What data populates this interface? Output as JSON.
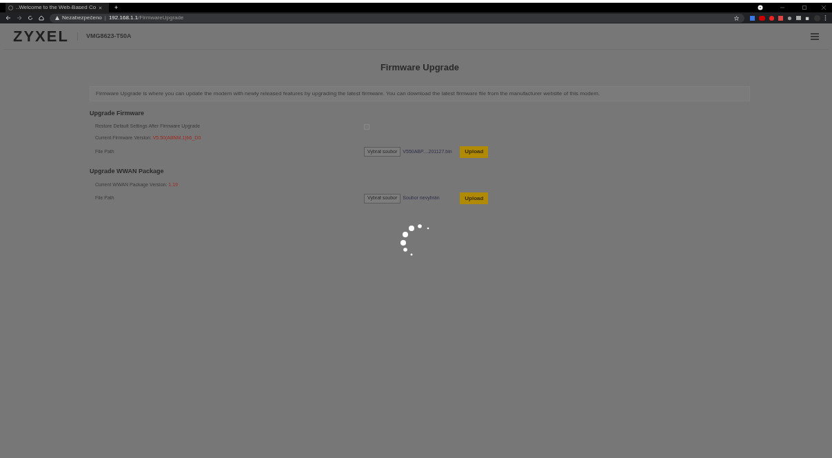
{
  "browser": {
    "tab_title": "..Welcome to the Web-Based Co",
    "new_tab": "+",
    "security": "Nezabezpečeno",
    "separator": "|",
    "url_host": "192.168.1.1",
    "url_path": "/FirmwareUpgrade"
  },
  "header": {
    "logo": "ZYXEL",
    "model": "VMG8623-T50A"
  },
  "page": {
    "title": "Firmware Upgrade",
    "description": "Firmware Upgrade is where you can update the modem with newly released features by upgrading the latest firmware. You can download the latest firmware file from the manufacturer website of this modem."
  },
  "sections": [
    {
      "title": "Upgrade Firmware",
      "rows": [
        {
          "kind": "checkbox",
          "label": "Restore Default Settings After Firmware Upgrade",
          "checked": false
        },
        {
          "kind": "version",
          "label": "Current Firmware Version: ",
          "value": "V5.50(ABNM.1)b6_D0"
        },
        {
          "kind": "file",
          "label": "File Path",
          "choose": "Vybrat soubor",
          "file": "V550ABP....201127.bin",
          "upload": "Upload"
        }
      ]
    },
    {
      "title": "Upgrade WWAN Package",
      "rows": [
        {
          "kind": "version",
          "label": "Current WWAN Package Version: ",
          "value": "1.19"
        },
        {
          "kind": "file",
          "label": "File Path",
          "choose": "Vybrat soubor",
          "file": "Soubor nevybrán",
          "upload": "Upload"
        }
      ]
    }
  ],
  "loading": true
}
